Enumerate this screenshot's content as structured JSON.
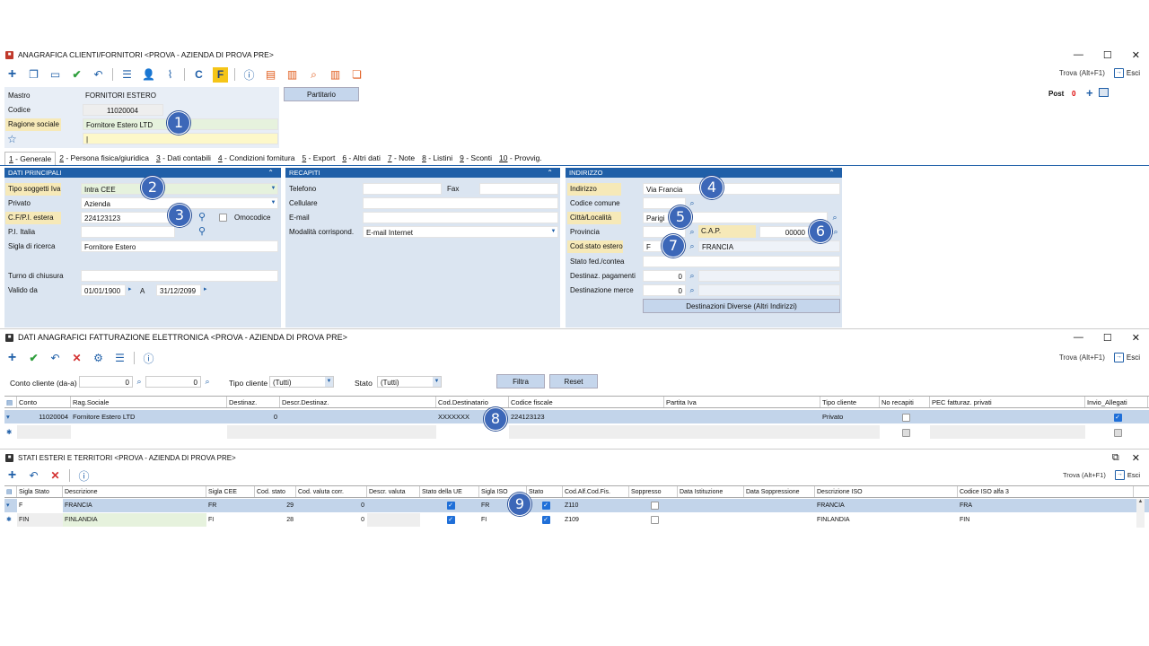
{
  "win1": {
    "title": "ANAGRAFICA CLIENTI/FORNITORI <PROVA - AZIENDA DI PROVA PRE>",
    "find": "Trova (Alt+F1)",
    "exit": "Esci",
    "post_label": "Post",
    "post_count": "0"
  },
  "head": {
    "mastro_label": "Mastro",
    "mastro_value": "FORNITORI ESTERO",
    "codice_label": "Codice",
    "codice_value": "11020004",
    "ragione_label": "Ragione sociale",
    "ragione_value": "Fornitore Estero LTD",
    "extra_value": "|",
    "partitario": "Partitario"
  },
  "tabs": [
    {
      "n": "1",
      "t": " - Generale"
    },
    {
      "n": "2",
      "t": " - Persona fisica/giuridica"
    },
    {
      "n": "3",
      "t": " - Dati contabili"
    },
    {
      "n": "4",
      "t": " - Condizioni fornitura"
    },
    {
      "n": "5",
      "t": " - Export"
    },
    {
      "n": "6",
      "t": " - Altri dati"
    },
    {
      "n": "7",
      "t": " - Note"
    },
    {
      "n": "8",
      "t": " - Listini"
    },
    {
      "n": "9",
      "t": " - Sconti"
    },
    {
      "n": "10",
      "t": " - Provvig."
    }
  ],
  "dp": {
    "title": "DATI PRINCIPALI",
    "tipo_label": "Tipo soggetti Iva",
    "tipo_value": "Intra CEE",
    "privato_label": "Privato",
    "privato_value": "Azienda",
    "cf_label": "C.F/P.I. estera",
    "cf_value": "224123123",
    "omocodice": "Omocodice",
    "pi_label": "P.I. Italia",
    "sigla_label": "Sigla di ricerca",
    "sigla_value": "Fornitore Estero",
    "turno_label": "Turno di chiusura",
    "valido_label": "Valido da",
    "valido_da": "01/01/1900",
    "a_label": "A",
    "valido_a": "31/12/2099"
  },
  "rec": {
    "title": "RECAPITI",
    "tel": "Telefono",
    "fax": "Fax",
    "cell": "Cellulare",
    "email": "E-mail",
    "mod_label": "Modalità corrispond.",
    "mod_value": "E-mail Internet"
  },
  "ind": {
    "title": "INDIRIZZO",
    "indirizzo_label": "Indirizzo",
    "indirizzo_value": "Via Francia",
    "comune_label": "Codice comune",
    "citta_label": "Città/Località",
    "citta_value": "Parigi",
    "prov_label": "Provincia",
    "cap_label": "C.A.P.",
    "cap_value": "00000",
    "stato_label": "Cod.stato estero",
    "stato_code": "F",
    "stato_name": "FRANCIA",
    "fed_label": "Stato fed./contea",
    "pag_label": "Destinaz. pagamenti",
    "pag_value": "0",
    "merce_label": "Destinazione merce",
    "merce_value": "0",
    "dest_btn": "Destinazioni Diverse (Altri Indirizzi)"
  },
  "win2": {
    "title": "DATI ANAGRAFICI FATTURAZIONE ELETTRONICA <PROVA - AZIENDA DI PROVA PRE>",
    "find": "Trova (Alt+F1)",
    "exit": "Esci",
    "conto_label": "Conto cliente (da-a)",
    "conto_da": "0",
    "conto_a": "0",
    "tipo_label": "Tipo cliente",
    "tipo_value": "(Tutti)",
    "stato_label": "Stato",
    "stato_value": "(Tutti)",
    "filtra": "Filtra",
    "reset": "Reset",
    "cols": [
      "Conto",
      "Rag.Sociale",
      "Destinaz.",
      "Descr.Destinaz.",
      "Cod.Destinatario",
      "Codice fiscale",
      "Partita Iva",
      "Tipo cliente",
      "No recapiti",
      "PEC fatturaz. privati",
      "Invio_Allegati"
    ],
    "row": {
      "conto": "11020004",
      "rag": "Fornitore Estero LTD",
      "dest": "0",
      "cod": "XXXXXXX",
      "cf": "224123123",
      "tipo": "Privato"
    }
  },
  "win3": {
    "title": "STATI ESTERI E TERRITORI <PROVA - AZIENDA DI PROVA PRE>",
    "find": "Trova (Alt+F1)",
    "exit": "Esci",
    "cols": [
      "Sigla Stato",
      "Descrizione",
      "Sigla CEE",
      "Cod. stato",
      "Cod. valuta corr.",
      "Descr. valuta",
      "Stato della UE",
      "Sigla ISO",
      "Stato",
      "Cod.Alf.Cod.Fis.",
      "Soppresso",
      "Data Istituzione",
      "Data Soppressione",
      "Descrizione ISO",
      "Codice ISO alfa 3"
    ],
    "rows": [
      {
        "sigla": "F",
        "desc": "FRANCIA",
        "cee": "FR",
        "cod": "29",
        "val": "0",
        "iso": "FR",
        "alf": "Z110",
        "diso": "FRANCIA",
        "iso3": "FRA"
      },
      {
        "sigla": "FIN",
        "desc": "FINLANDIA",
        "cee": "FI",
        "cod": "28",
        "val": "0",
        "iso": "FI",
        "alf": "Z109",
        "diso": "FINLANDIA",
        "iso3": "FIN"
      }
    ]
  },
  "badges": [
    "1",
    "2",
    "3",
    "4",
    "5",
    "6",
    "7",
    "8",
    "9"
  ]
}
